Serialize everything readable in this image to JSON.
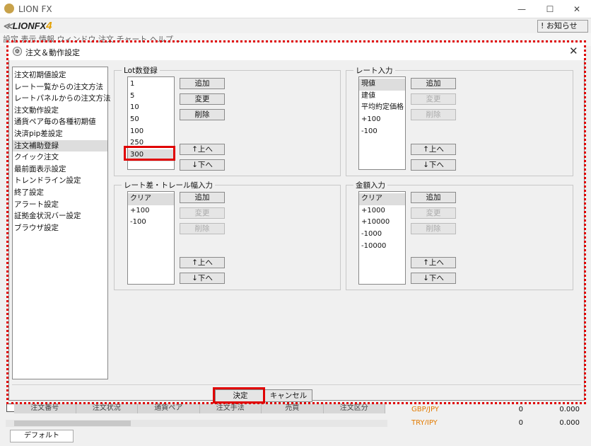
{
  "app": {
    "title": "LION FX",
    "logo_text": "LIONFX",
    "logo_version": "4",
    "notice_button": "! お知らせ",
    "menubar_text": "設定  表示  情報  ウィンドウ  注文  チャート  ヘルプ  ...",
    "window_controls": [
      "—",
      "☐",
      "✕"
    ]
  },
  "background": {
    "table_headers": [
      "注文番号",
      "注文状況",
      "通貨ペア",
      "注文手法",
      "売買",
      "注文区分"
    ],
    "rates": [
      {
        "pair": "GBP/JPY",
        "v1": "0",
        "v2": "0.000"
      },
      {
        "pair": "TRY/JPY",
        "v1": "0",
        "v2": "0.000"
      }
    ],
    "tab_label": "デフォルト"
  },
  "dialog": {
    "title": "注文＆動作設定",
    "close_glyph": "✕",
    "icon_glyph": "⚙",
    "categories": [
      "注文初期値設定",
      "レート一覧からの注文方法",
      "レートパネルからの注文方法",
      "注文動作設定",
      "通貨ペア毎の各種初期値",
      "決済pip差設定",
      "注文補助登録",
      "クイック注文",
      "最前面表示設定",
      "トレンドライン設定",
      "終了設定",
      "アラート設定",
      "証拠金状況バー設定",
      "ブラウザ設定"
    ],
    "selected_category": "注文補助登録",
    "lot_group": {
      "label": "Lot数登録",
      "items": [
        "1",
        "5",
        "10",
        "50",
        "100",
        "250",
        "300"
      ],
      "selected": "300",
      "buttons": {
        "add": "追加",
        "change": "変更",
        "delete": "削除",
        "up": "↑上へ",
        "down": "↓下へ"
      }
    },
    "rate_group": {
      "label": "レート入力",
      "items": [
        "現値",
        "建値",
        "平均約定価格",
        "+100",
        "-100"
      ],
      "selected": "現値",
      "buttons": {
        "add": "追加",
        "change": "変更",
        "delete": "削除",
        "up": "↑上へ",
        "down": "↓下へ"
      }
    },
    "trail_group": {
      "label": "レート差・トレール幅入力",
      "items": [
        "クリア",
        "+100",
        "-100"
      ],
      "selected": "クリア",
      "buttons": {
        "add": "追加",
        "change": "変更",
        "delete": "削除",
        "up": "↑上へ",
        "down": "↓下へ"
      }
    },
    "amount_group": {
      "label": "金額入力",
      "items": [
        "クリア",
        "+1000",
        "+10000",
        "-1000",
        "-10000"
      ],
      "selected": "クリア",
      "buttons": {
        "add": "追加",
        "change": "変更",
        "delete": "削除",
        "up": "↑上へ",
        "down": "↓下へ"
      }
    },
    "ok_label": "決定",
    "cancel_label": "キャンセル"
  },
  "colors": {
    "highlight": "#e00000",
    "selected_row": "#dddddd",
    "accent_orange": "#e37b00"
  }
}
